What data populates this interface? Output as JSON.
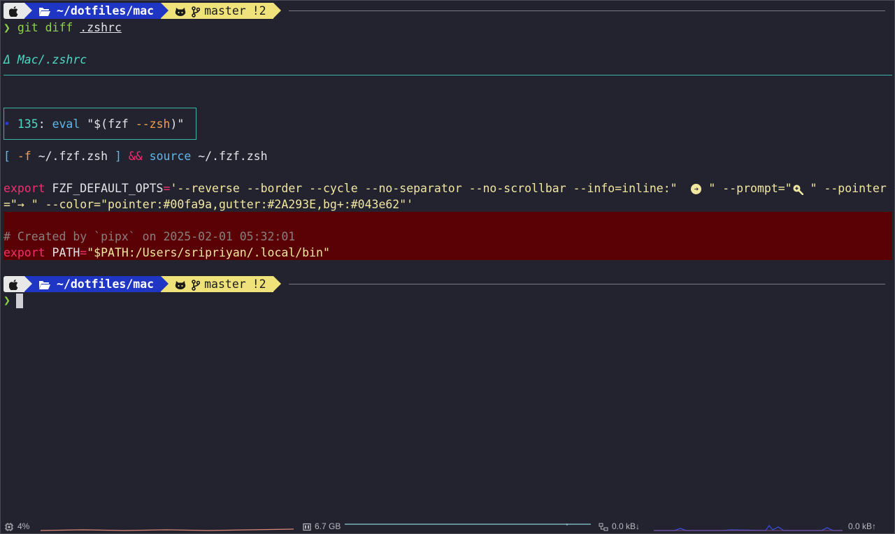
{
  "prompt1": {
    "apple_icon": "apple-icon",
    "folder_icon": "folder-open-icon",
    "path": "~/dotfiles/mac",
    "github_icon": "octocat-icon",
    "branch_icon": "git-branch-icon",
    "branch": "master",
    "changes": "!2"
  },
  "command": {
    "chevron": "❯",
    "cmd": "git diff",
    "arg": ".zshrc"
  },
  "diff": {
    "file_header": "Δ Mac/.zshrc",
    "hunk": {
      "dot": "•",
      "line_no": "135",
      "sep": ":",
      "func": "eval",
      "text_a": "\"$(",
      "text_b": "fzf",
      "text_c": "--zsh",
      "text_d": ")\""
    },
    "line1": {
      "open": "[",
      "flag": "-f",
      "path": "~/.fzf.zsh",
      "close": "]",
      "and": "&&",
      "source": "source",
      "path2": "~/.fzf.zsh"
    },
    "line2": {
      "export": "export",
      "var": "FZF_DEFAULT_OPTS",
      "eq": "=",
      "value_part1": "'--reverse --border --cycle --no-separator --no-scrollbar --info=inline:\"",
      "value_part2": "\" --prompt=\"",
      "value_part3": " \" --pointer",
      "value_line2_a": "=\"",
      "value_line2_arrow": "→",
      "value_line2_b": " \" --color=\"pointer:#00fa9a,gutter:#2A293E,bg+:#043e62\"'"
    },
    "removed": {
      "comment": "# Created by `pipx` on 2025-02-01 05:32:01",
      "export": "export",
      "var": "PATH",
      "eq": "=",
      "value": "\"$PATH:/Users/sripriyan/.local/bin\""
    }
  },
  "prompt2": {
    "path": "~/dotfiles/mac",
    "branch": "master",
    "changes": "!2",
    "chevron": "❯"
  },
  "status_bar": {
    "cpu_icon": "cpu-icon",
    "cpu": "4%",
    "mem_icon": "memory-icon",
    "mem": "6.7 GB",
    "net_icon": "network-icon",
    "down": "0.0 kB↓",
    "up": "0.0 kB↑"
  },
  "colors": {
    "bg": "#232330",
    "removed_bg": "#5a0105",
    "path_segment": "#1f35c4",
    "git_segment": "#f0e27a",
    "accent_teal": "#3fb3a6"
  }
}
